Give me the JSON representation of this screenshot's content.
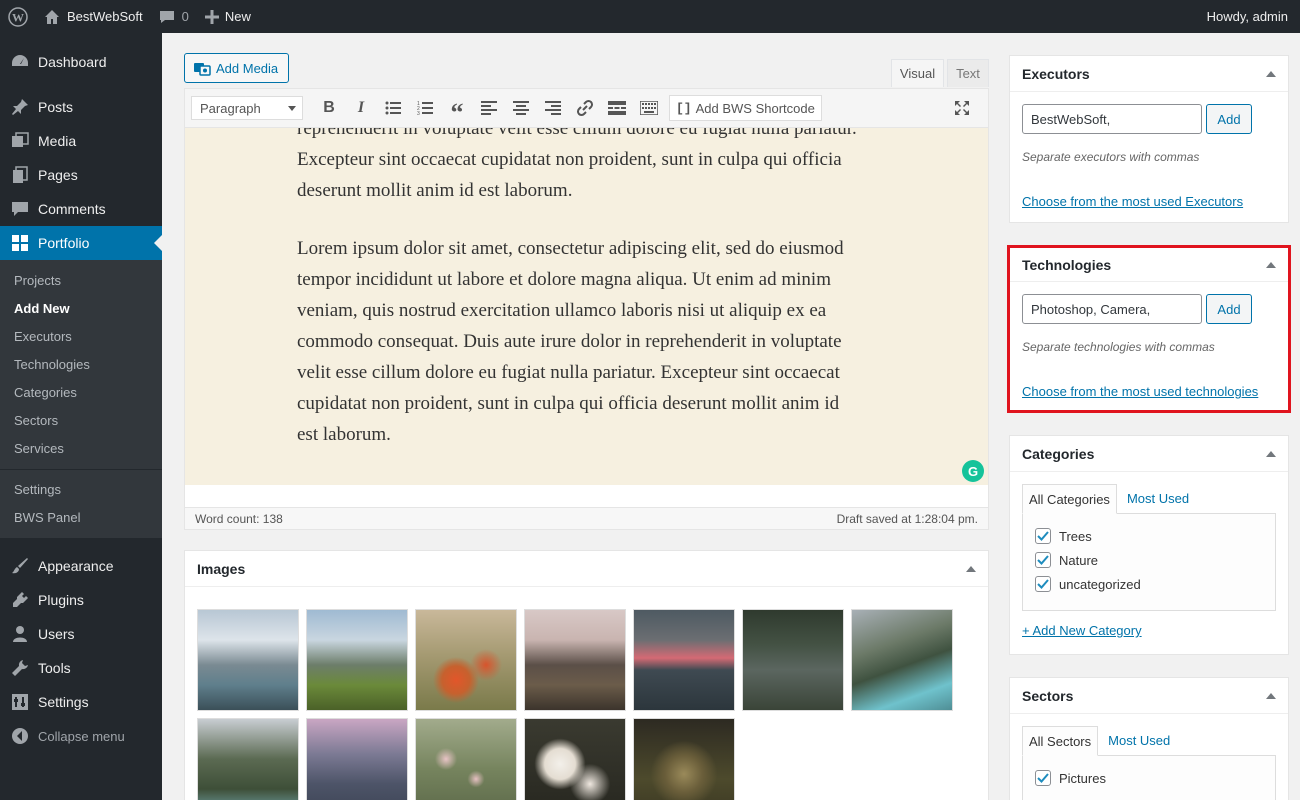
{
  "adminbar": {
    "site_name": "BestWebSoft",
    "comments_count": "0",
    "new_label": "New",
    "howdy": "Howdy, admin"
  },
  "sidebar": {
    "items_top": [
      {
        "label": "Dashboard",
        "icon": "dashboard-icon"
      },
      {
        "label": "Posts",
        "icon": "pin-icon"
      },
      {
        "label": "Media",
        "icon": "media-icon"
      },
      {
        "label": "Pages",
        "icon": "pages-icon"
      },
      {
        "label": "Comments",
        "icon": "comments-icon"
      },
      {
        "label": "Portfolio",
        "icon": "grid-icon"
      }
    ],
    "submenu": [
      "Projects",
      "Add New",
      "Executors",
      "Technologies",
      "Categories",
      "Sectors",
      "Services",
      "Settings",
      "BWS Panel"
    ],
    "items_bottom": [
      {
        "label": "Appearance",
        "icon": "brush-icon"
      },
      {
        "label": "Plugins",
        "icon": "plugin-icon"
      },
      {
        "label": "Users",
        "icon": "user-icon"
      },
      {
        "label": "Tools",
        "icon": "wrench-icon"
      },
      {
        "label": "Settings",
        "icon": "settings-icon"
      }
    ],
    "collapse_label": "Collapse menu"
  },
  "editor": {
    "add_media_label": "Add Media",
    "tab_visual": "Visual",
    "tab_text": "Text",
    "format_value": "Paragraph",
    "bws_shortcode_label": "Add BWS Shortcode",
    "paragraph_1": "reprehenderit in voluptate velit esse cillum dolore eu fugiat nulla pariatur. Excepteur sint occaecat cupidatat non proident, sunt in culpa qui officia deserunt mollit anim id est laborum.",
    "paragraph_2": "Lorem ipsum dolor sit amet, consectetur adipiscing elit, sed do eiusmod tempor incididunt ut labore et dolore magna aliqua. Ut enim ad minim veniam, quis nostrud exercitation ullamco laboris nisi ut aliquip ex ea commodo consequat. Duis aute irure dolor in reprehenderit in voluptate velit esse cillum dolore eu fugiat nulla pariatur. Excepteur sint occaecat cupidatat non proident, sunt in culpa qui officia deserunt mollit anim id est laborum.",
    "word_count": "Word count: 138",
    "draft_saved": "Draft saved at 1:28:04 pm."
  },
  "images_box": {
    "title": "Images"
  },
  "executors": {
    "title": "Executors",
    "input_value": "BestWebSoft,",
    "add_label": "Add",
    "hint": "Separate executors with commas",
    "choose_link": "Choose from the most used Executors"
  },
  "technologies": {
    "title": "Technologies",
    "input_value": "Photoshop, Camera,",
    "add_label": "Add",
    "hint": "Separate technologies with commas",
    "choose_link": "Choose from the most used technologies"
  },
  "categories": {
    "title": "Categories",
    "tab_all": "All Categories",
    "tab_most_used": "Most Used",
    "items": [
      "Trees",
      "Nature",
      "uncategorized"
    ],
    "add_new": "+ Add New Category"
  },
  "sectors": {
    "title": "Sectors",
    "tab_all": "All Sectors",
    "tab_most_used": "Most Used",
    "items": [
      "Pictures"
    ]
  },
  "colors": {
    "accent": "#0073aa",
    "highlight_border": "#e0141e",
    "sidebar_bg": "#23282d",
    "editor_bg": "#f6f0e0"
  }
}
